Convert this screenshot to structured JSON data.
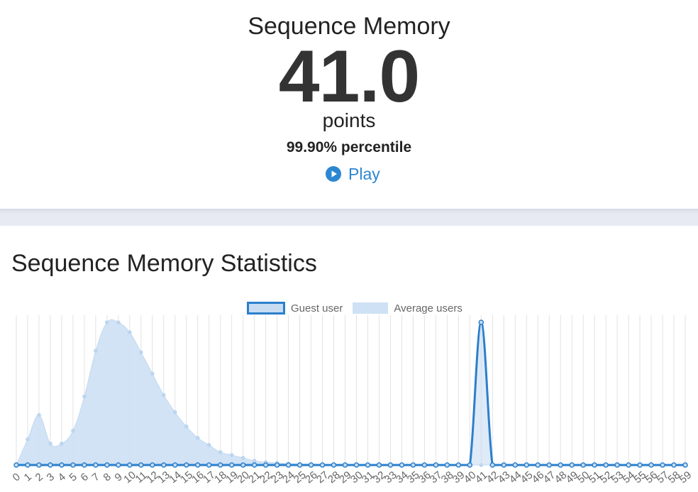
{
  "result": {
    "game_title": "Sequence Memory",
    "score": "41.0",
    "unit": "points",
    "percentile": "99.90% percentile",
    "play_label": "Play",
    "play_icon": "play-circle-icon"
  },
  "stats": {
    "heading": "Sequence Memory Statistics"
  },
  "colors": {
    "accent": "#2b87d1",
    "guest_line": "#2b7fcc",
    "avg_fill": "#cfe1f4",
    "grid": "#e0e0e0"
  },
  "chart_data": {
    "type": "area",
    "title": "",
    "xlabel": "",
    "ylabel": "",
    "grid": true,
    "legend": "top-center",
    "categories": [
      "0",
      "1",
      "2",
      "3",
      "4",
      "5",
      "6",
      "7",
      "8",
      "9",
      "10",
      "11",
      "12",
      "13",
      "14",
      "15",
      "16",
      "17",
      "18",
      "19",
      "20",
      "21",
      "22",
      "23",
      "24",
      "25",
      "26",
      "27",
      "28",
      "29",
      "30",
      "31",
      "32",
      "33",
      "34",
      "35",
      "36",
      "37",
      "38",
      "39",
      "40",
      "41",
      "42",
      "43",
      "44",
      "45",
      "46",
      "47",
      "48",
      "49",
      "50",
      "51",
      "52",
      "53",
      "54",
      "55",
      "56",
      "57",
      "58",
      "59"
    ],
    "ylim": [
      0,
      100
    ],
    "series": [
      {
        "name": "Guest user",
        "values": [
          0,
          0,
          0,
          0,
          0,
          0,
          0,
          0,
          0,
          0,
          0,
          0,
          0,
          0,
          0,
          0,
          0,
          0,
          0,
          0,
          0,
          0,
          0,
          0,
          0,
          0,
          0,
          0,
          0,
          0,
          0,
          0,
          0,
          0,
          0,
          0,
          0,
          0,
          0,
          0,
          0,
          100,
          0,
          0,
          0,
          0,
          0,
          0,
          0,
          0,
          0,
          0,
          0,
          0,
          0,
          0,
          0,
          0,
          0,
          0
        ]
      },
      {
        "name": "Average users",
        "values": [
          0,
          18,
          35,
          15,
          15,
          24,
          48,
          80,
          100,
          100,
          93,
          79,
          64,
          49,
          37,
          27,
          19,
          14,
          9,
          7,
          5,
          3,
          2,
          1.5,
          1,
          0.8,
          0.6,
          0.5,
          0.4,
          0.3,
          0.2,
          0.2,
          0.1,
          0.1,
          0.1,
          0.1,
          0.1,
          0.1,
          0,
          0,
          0,
          0,
          0,
          0,
          0,
          0,
          0,
          0,
          0,
          0,
          0,
          0,
          0,
          0,
          0,
          0,
          0,
          0,
          0,
          0
        ]
      }
    ]
  }
}
